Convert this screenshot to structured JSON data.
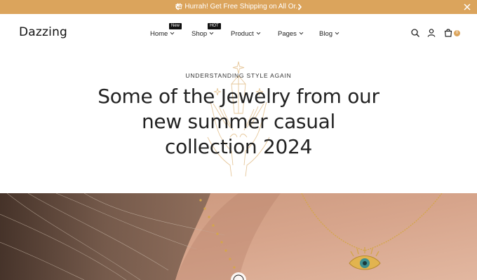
{
  "announcement": {
    "text": "Hurrah! Get Free Shipping on All Or...",
    "icons": {
      "gift": "gift-icon",
      "prev": "chevron-left-icon",
      "next": "chevron-right-icon",
      "close": "close-icon"
    }
  },
  "header": {
    "logo": "Dazzing",
    "nav": [
      {
        "label": "Home",
        "badge": "New"
      },
      {
        "label": "Shop",
        "badge": "HOT"
      },
      {
        "label": "Product"
      },
      {
        "label": "Pages"
      },
      {
        "label": "Blog"
      }
    ],
    "icons": {
      "search": "search-icon",
      "account": "user-icon",
      "cart": "cart-icon"
    },
    "cart_count": "0"
  },
  "hero": {
    "eyebrow": "UNDERSTANDING STYLE AGAIN",
    "headline_lines": [
      "Some of the Jewelry from our",
      "new summer casual",
      "collection 2024"
    ]
  },
  "colors": {
    "accent": "#dba45c",
    "text": "#222222",
    "badge": "#111111",
    "background": "#ffffff"
  }
}
